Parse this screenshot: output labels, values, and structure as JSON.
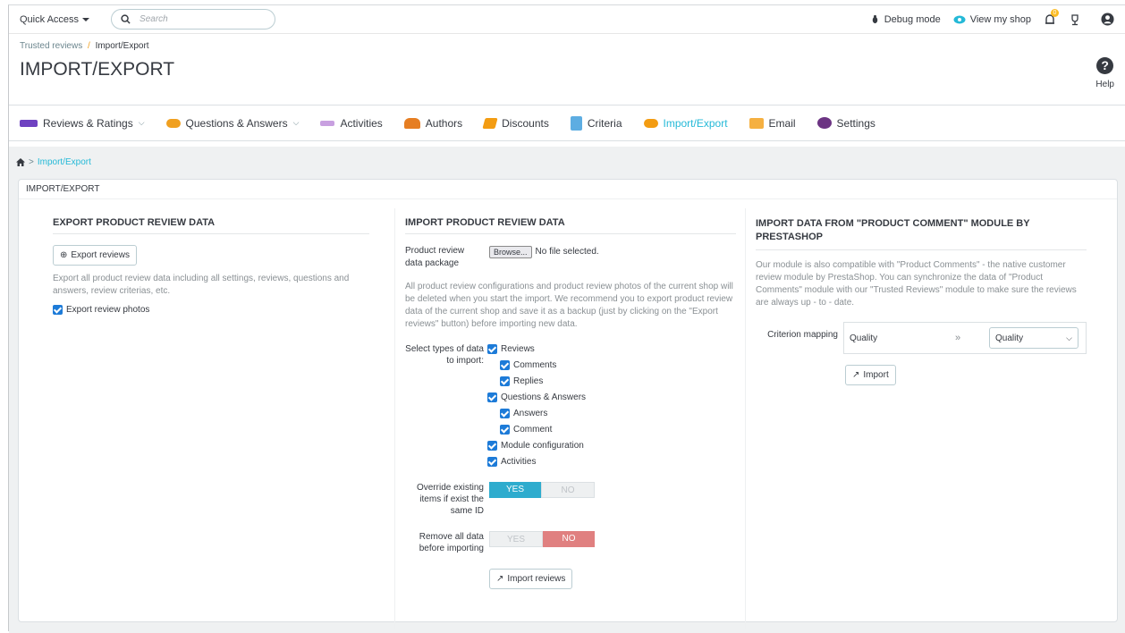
{
  "topbar": {
    "quick_access": "Quick Access",
    "search_placeholder": "Search",
    "debug_mode": "Debug mode",
    "view_shop": "View my shop",
    "notif_count": "0"
  },
  "header": {
    "breadcrumb_parent": "Trusted reviews",
    "breadcrumb_sep": "/",
    "breadcrumb_current": "Import/Export",
    "title": "IMPORT/EXPORT",
    "help_label": "Help"
  },
  "tabs": [
    {
      "label": "Reviews & Ratings",
      "dropdown": true,
      "color": "#6f42c1"
    },
    {
      "label": "Questions & Answers",
      "dropdown": true,
      "color": "#f0a020"
    },
    {
      "label": "Activities",
      "dropdown": false,
      "color": "#9b59b6"
    },
    {
      "label": "Authors",
      "dropdown": false,
      "color": "#e67e22"
    },
    {
      "label": "Discounts",
      "dropdown": false,
      "color": "#f39c12"
    },
    {
      "label": "Criteria",
      "dropdown": false,
      "color": "#3498db"
    },
    {
      "label": "Import/Export",
      "dropdown": false,
      "active": true,
      "color": "#f39c12"
    },
    {
      "label": "Email",
      "dropdown": false,
      "color": "#e74c3c"
    },
    {
      "label": "Settings",
      "dropdown": false,
      "color": "#8e44ad"
    }
  ],
  "content": {
    "breadcrumb_sep": ">",
    "breadcrumb_link": "Import/Export",
    "panel_title": "IMPORT/EXPORT"
  },
  "export": {
    "heading": "EXPORT PRODUCT REVIEW DATA",
    "button": "Export reviews",
    "description": "Export all product review data including all settings, reviews, questions and answers, review criterias, etc.",
    "photos_label": "Export review photos"
  },
  "import": {
    "heading": "IMPORT PRODUCT REVIEW DATA",
    "package_label": "Product review data package",
    "browse": "Browse...",
    "no_file": "No file selected.",
    "description": "All product review configurations and product review photos of the current shop will be deleted when you start the import. We recommend you to export product review data of the current shop and save it as a backup (just by clicking on the \"Export reviews\" button) before importing new data.",
    "types_label": "Select types of data to import:",
    "types": [
      {
        "label": "Reviews",
        "level": 0
      },
      {
        "label": "Comments",
        "level": 1
      },
      {
        "label": "Replies",
        "level": 1
      },
      {
        "label": "Questions & Answers",
        "level": 0
      },
      {
        "label": "Answers",
        "level": 1
      },
      {
        "label": "Comment",
        "level": 1
      },
      {
        "label": "Module configuration",
        "level": 0
      },
      {
        "label": "Activities",
        "level": 0
      }
    ],
    "override_label": "Override existing items if exist the same ID",
    "override_yes": "YES",
    "override_no": "NO",
    "remove_label": "Remove all data before importing",
    "remove_yes": "YES",
    "remove_no": "NO",
    "button": "Import reviews"
  },
  "comment_module": {
    "heading": "IMPORT DATA FROM \"PRODUCT COMMENT\" MODULE BY PRESTASHOP",
    "description": "Our module is also compatible with \"Product Comments\" - the native customer review module by PrestaShop. You can synchronize the data of \"Product Comments\" module with our \"Trusted Reviews\" module to make sure the reviews are always up - to - date.",
    "mapping_label": "Criterion mapping",
    "source": "Quality",
    "arrow": "»",
    "target": "Quality",
    "button": "Import"
  },
  "colors": {
    "accent": "#25b9d7",
    "yes_active": "#2eacce",
    "no_active": "#e08080",
    "checkbox": "#1d7bd8"
  }
}
